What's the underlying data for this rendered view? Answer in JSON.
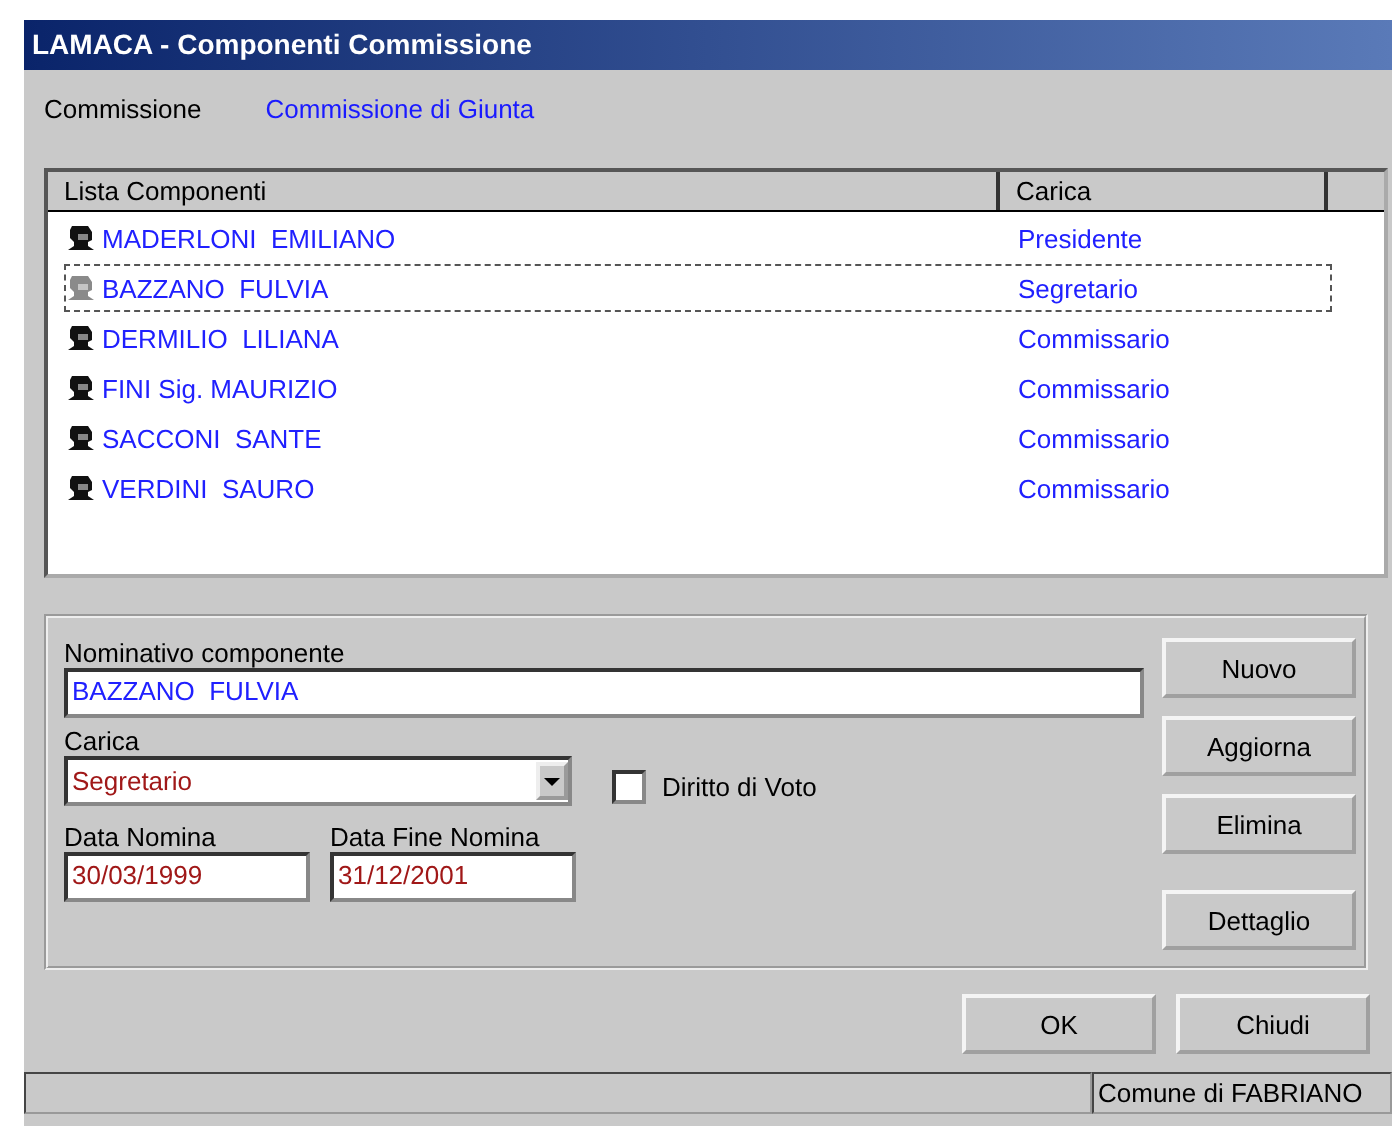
{
  "window": {
    "title": "LAMACA - Componenti Commissione"
  },
  "commissione": {
    "label": "Commissione",
    "value": "Commissione di Giunta"
  },
  "list": {
    "columns": [
      "Lista Componenti",
      "Carica"
    ],
    "rows": [
      {
        "name": "MADERLONI  EMILIANO",
        "carica": "Presidente",
        "selected": false
      },
      {
        "name": "BAZZANO  FULVIA",
        "carica": "Segretario",
        "selected": true
      },
      {
        "name": "DERMILIO  LILIANA",
        "carica": "Commissario",
        "selected": false
      },
      {
        "name": "FINI Sig. MAURIZIO",
        "carica": "Commissario",
        "selected": false
      },
      {
        "name": "SACCONI  SANTE",
        "carica": "Commissario",
        "selected": false
      },
      {
        "name": "VERDINI  SAURO",
        "carica": "Commissario",
        "selected": false
      }
    ]
  },
  "form": {
    "nominativo": {
      "label": "Nominativo componente",
      "value": "BAZZANO  FULVIA"
    },
    "carica": {
      "label": "Carica",
      "value": "Segretario"
    },
    "diritto_di_voto": {
      "label": "Diritto di Voto",
      "checked": false
    },
    "data_nomina": {
      "label": "Data Nomina",
      "value": "30/03/1999"
    },
    "data_fine_nomina": {
      "label": "Data Fine Nomina",
      "value": "31/12/2001"
    },
    "buttons": [
      "Nuovo",
      "Aggiorna",
      "Elimina",
      "Dettaglio"
    ]
  },
  "buttons": [
    "OK",
    "Chiudi"
  ],
  "status_bar": {
    "text": "Comune di FABRIANO"
  }
}
